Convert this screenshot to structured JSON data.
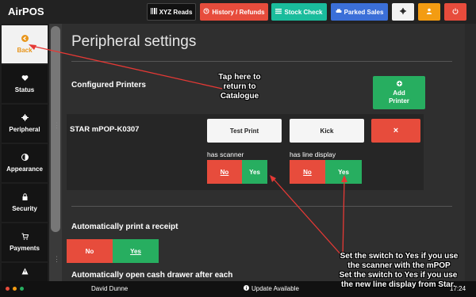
{
  "app": {
    "title": "AirPOS"
  },
  "topbar": {
    "xyz_reads": "XYZ Reads",
    "history_refunds": "History / Refunds",
    "stock_check": "Stock Check",
    "parked_sales": "Parked Sales",
    "colors": {
      "xyz": "#111111",
      "history": "#e74c3c",
      "stock": "#1abc9c",
      "parked": "#3b6fd8",
      "settings": "#f2f2f2",
      "user": "#f39c12",
      "power": "#e74c3c"
    }
  },
  "sidebar": {
    "items": [
      {
        "label": "Back",
        "icon": "arrow-circle-left-icon"
      },
      {
        "label": "Status",
        "icon": "heartbeat-icon"
      },
      {
        "label": "Peripheral",
        "icon": "gear-icon"
      },
      {
        "label": "Appearance",
        "icon": "contrast-icon"
      },
      {
        "label": "Security",
        "icon": "lock-icon"
      },
      {
        "label": "Payments",
        "icon": "cart-icon"
      },
      {
        "label": "",
        "icon": "warning-icon"
      }
    ]
  },
  "main": {
    "title": "Peripheral settings",
    "configured_printers": "Configured Printers",
    "add_printer": "Add Printer",
    "printer": {
      "name": "STAR mPOP-K0307",
      "test_print": "Test Print",
      "kick": "Kick",
      "delete": "×",
      "has_scanner_label": "has scanner",
      "has_line_display_label": "has line display",
      "scanner_toggle": {
        "no": "No",
        "yes": "Yes",
        "selected": "Yes"
      },
      "line_display_toggle": {
        "no": "No",
        "yes": "Yes",
        "selected": "Yes"
      }
    },
    "auto_print_label": "Automatically print a receipt",
    "auto_print_toggle": {
      "no": "No",
      "yes": "Yes",
      "selected": "Yes"
    },
    "auto_drawer_label": "Automatically open cash drawer after each"
  },
  "annotations": {
    "catalogue": "Tap here to return to Catalogue",
    "switch_note_1": "Set the switch to Yes if you use the scanner with the mPOP",
    "switch_note_2": "Set the switch to Yes if you use the new line display from Star."
  },
  "bottombar": {
    "user": "David Dunne",
    "update": "Update Available",
    "time": "17:24",
    "dot_colors": [
      "#e74c3c",
      "#f39c12",
      "#27ae60"
    ]
  }
}
